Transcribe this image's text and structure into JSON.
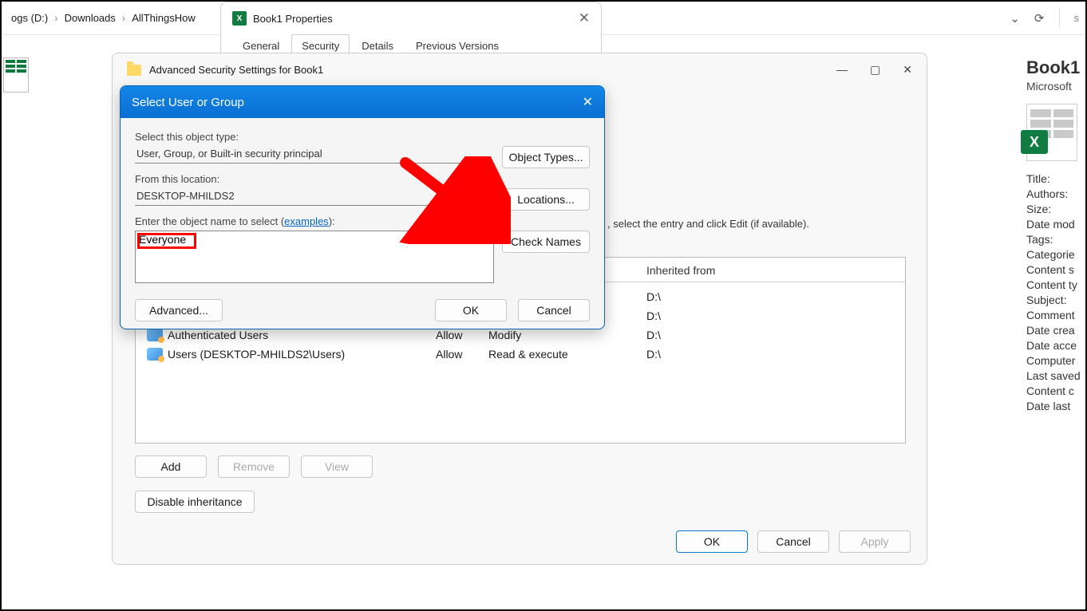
{
  "breadcrumbs": {
    "a": "ogs (D:)",
    "b": "Downloads",
    "c": "AllThingsHow"
  },
  "properties": {
    "title": "Book1 Properties",
    "tabs": {
      "general": "General",
      "security": "Security",
      "details": "Details",
      "previous": "Previous Versions"
    }
  },
  "advanced": {
    "title": "Advanced Security Settings for Book1",
    "hint": ", select the entry and click Edit (if available).",
    "table": {
      "headers": {
        "inherited": "Inherited from"
      },
      "rows": [
        {
          "principal": "Authenticated Users",
          "type": "Allow",
          "access": "Modify",
          "inherited": "D:\\"
        },
        {
          "principal": "Users (DESKTOP-MHILDS2\\Users)",
          "type": "Allow",
          "access": "Read & execute",
          "inherited": "D:\\"
        }
      ],
      "extra_inherited": [
        "D:\\",
        "D:\\"
      ]
    },
    "buttons": {
      "add": "Add",
      "remove": "Remove",
      "view": "View",
      "disable": "Disable inheritance",
      "ok": "OK",
      "cancel": "Cancel",
      "apply": "Apply"
    }
  },
  "select": {
    "title": "Select User or Group",
    "labels": {
      "object_type": "Select this object type:",
      "from_location": "From this location:",
      "enter_name_pre": "Enter the object name to select (",
      "examples": "examples",
      "enter_name_post": "):"
    },
    "values": {
      "object_type": "User, Group, or Built-in security principal",
      "location": "DESKTOP-MHILDS2",
      "entered": "Everyone"
    },
    "buttons": {
      "object_types": "Object Types...",
      "locations": "Locations...",
      "check_names": "Check Names",
      "advanced": "Advanced...",
      "ok": "OK",
      "cancel": "Cancel"
    }
  },
  "details_pane": {
    "title": "Book1",
    "subtitle": "Microsoft",
    "props": [
      "Title:",
      "Authors:",
      "Size:",
      "Date mod",
      "Tags:",
      "Categorie",
      "Content s",
      "Content ty",
      "Subject:",
      "Comment",
      "Date crea",
      "Date acce",
      "Computer",
      "Last saved",
      "Content c",
      "Date last"
    ]
  }
}
